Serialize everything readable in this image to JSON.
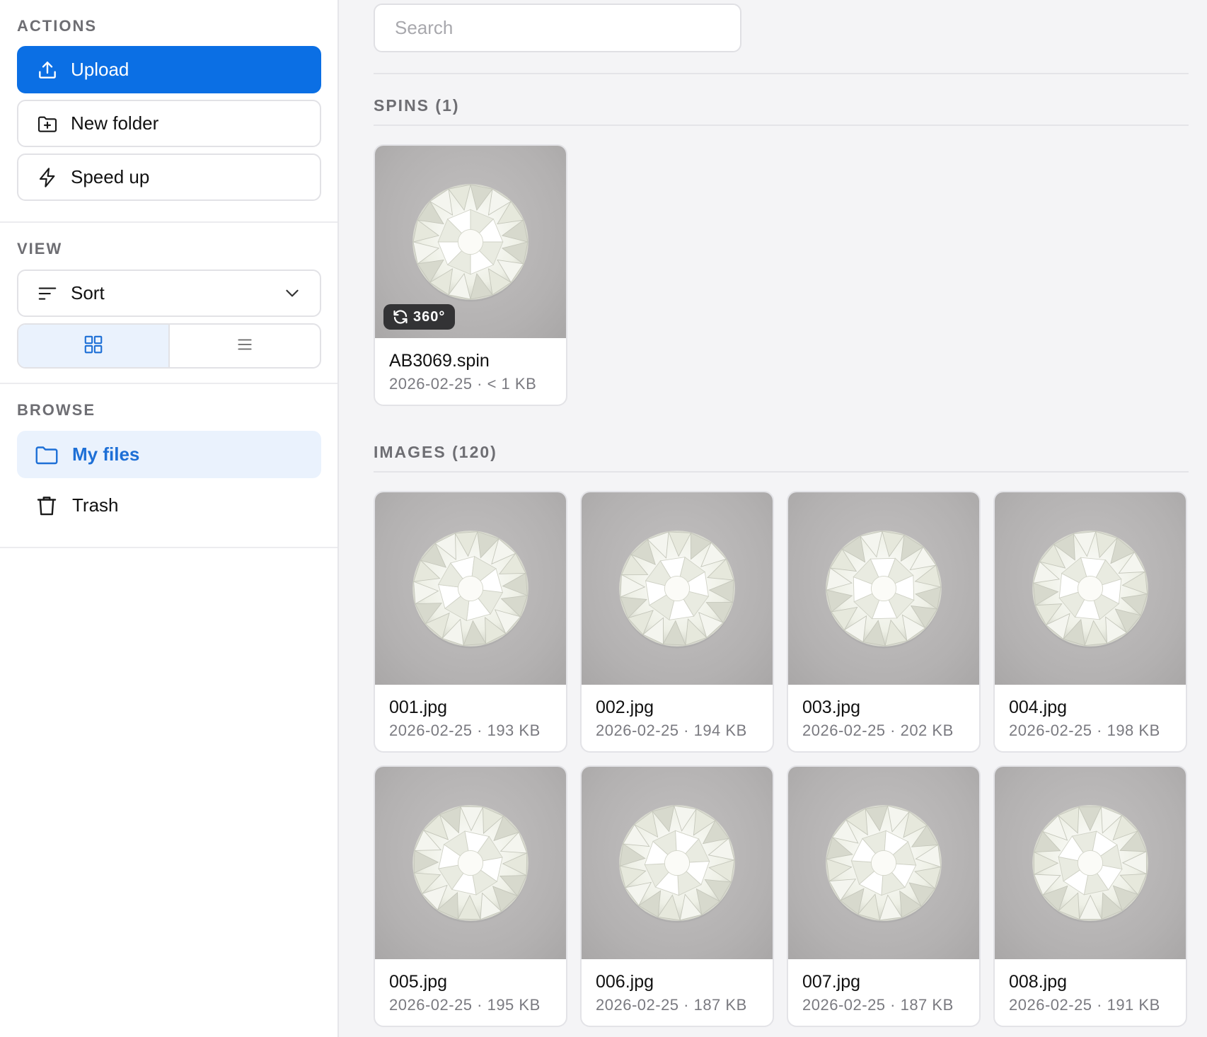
{
  "sidebar": {
    "actions": {
      "title": "ACTIONS",
      "upload_label": "Upload",
      "new_folder_label": "New folder",
      "speed_up_label": "Speed up"
    },
    "view": {
      "title": "VIEW",
      "sort_label": "Sort",
      "mode": "grid"
    },
    "browse": {
      "title": "BROWSE",
      "items": [
        {
          "label": "My files",
          "icon": "folder-icon",
          "active": true
        },
        {
          "label": "Trash",
          "icon": "trash-icon",
          "active": false
        }
      ]
    }
  },
  "search": {
    "placeholder": "Search",
    "value": ""
  },
  "spins": {
    "title": "SPINS (1)",
    "items": [
      {
        "name": "AB3069.spin",
        "meta": "2026-02-25 · < 1 KB",
        "badge": "360°"
      }
    ]
  },
  "images": {
    "title": "IMAGES (120)",
    "items": [
      {
        "name": "001.jpg",
        "meta": "2026-02-25 · 193 KB"
      },
      {
        "name": "002.jpg",
        "meta": "2026-02-25 · 194 KB"
      },
      {
        "name": "003.jpg",
        "meta": "2026-02-25 · 202 KB"
      },
      {
        "name": "004.jpg",
        "meta": "2026-02-25 · 198 KB"
      },
      {
        "name": "005.jpg",
        "meta": "2026-02-25 · 195 KB"
      },
      {
        "name": "006.jpg",
        "meta": "2026-02-25 · 187 KB"
      },
      {
        "name": "007.jpg",
        "meta": "2026-02-25 · 187 KB"
      },
      {
        "name": "008.jpg",
        "meta": "2026-02-25 · 191 KB"
      }
    ]
  },
  "colors": {
    "accent": "#0b6fe4",
    "active_nav_bg": "#eaf2fd",
    "active_nav_text": "#1d6fd6"
  }
}
